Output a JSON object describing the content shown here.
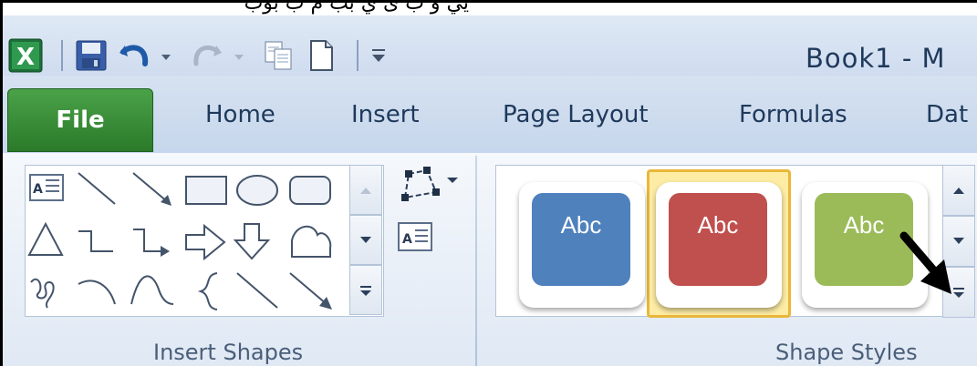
{
  "window": {
    "title": "Book1 - M",
    "top_text": "يي و ب ى ي بب م ب بوب"
  },
  "quick_access": {
    "items": [
      "excel-logo",
      "save",
      "undo",
      "undo-dropdown",
      "redo",
      "redo-dropdown",
      "copy",
      "new",
      "customize"
    ]
  },
  "tabs": [
    {
      "label": "File",
      "active": true
    },
    {
      "label": "Home"
    },
    {
      "label": "Insert"
    },
    {
      "label": "Page Layout"
    },
    {
      "label": "Formulas"
    },
    {
      "label": "Dat"
    }
  ],
  "groups": {
    "insert_shapes": {
      "label": "Insert Shapes",
      "shapes": [
        "text-box",
        "line",
        "arrow",
        "rectangle",
        "oval",
        "rounded-rectangle",
        "triangle",
        "elbow-connector",
        "elbow-arrow",
        "right-arrow",
        "down-arrow",
        "freeform",
        "scribble",
        "arc",
        "curve",
        "left-brace",
        "line",
        "arrow"
      ]
    },
    "shape_styles": {
      "label": "Shape Styles",
      "styles": [
        {
          "label": "Abc",
          "color": "#4f81bd",
          "selected": false
        },
        {
          "label": "Abc",
          "color": "#c0504d",
          "selected": true
        },
        {
          "label": "Abc",
          "color": "#9bbb59",
          "selected": false
        }
      ]
    }
  },
  "colors": {
    "file_tab": "#3a8f38",
    "ribbon_bg": "#eaf0f8",
    "selection": "#fdeca4"
  }
}
